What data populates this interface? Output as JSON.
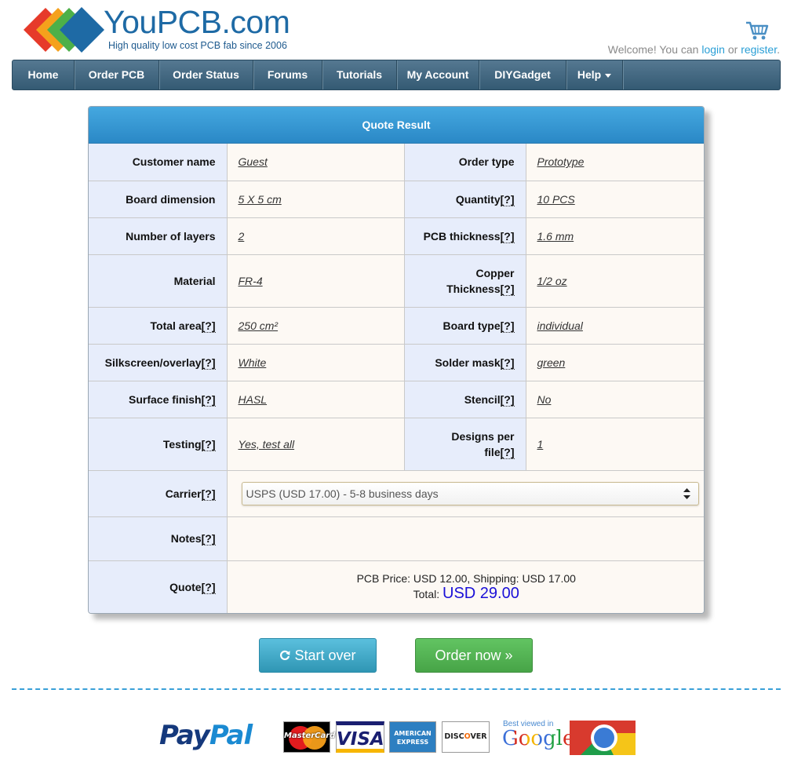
{
  "brand": {
    "name_you": "You",
    "name_pcb": "PCB",
    "name_dom": ".com",
    "tagline": "High quality low cost PCB fab since 2006"
  },
  "account": {
    "welcome_text": "Welcome! You can ",
    "login": "login",
    "or": " or ",
    "register": "register",
    "period": "."
  },
  "nav": [
    {
      "label": "Home"
    },
    {
      "label": "Order PCB"
    },
    {
      "label": "Order Status"
    },
    {
      "label": "Forums"
    },
    {
      "label": "Tutorials"
    },
    {
      "label": "My Account"
    },
    {
      "label": "DIYGadget"
    },
    {
      "label": "Help"
    }
  ],
  "quote": {
    "title": "Quote Result",
    "help_mark": "[?]",
    "rows": [
      {
        "l1": "Customer name",
        "v1": "Guest",
        "l2": "Order type",
        "v2": "Prototype"
      },
      {
        "l1": "Board dimension",
        "v1": "5 X 5 cm",
        "l2": "Quantity",
        "v2": "10 PCS"
      },
      {
        "l1": "Number of layers",
        "v1": "2",
        "l2": "PCB thickness",
        "v2": "1.6 mm"
      },
      {
        "l1": "Material",
        "v1": "FR-4",
        "l2a": "Copper",
        "l2b": "Thickness",
        "v2": "1/2 oz"
      },
      {
        "l1": "Total area",
        "v1": "250 cm²",
        "l2": "Board type",
        "v2": "individual"
      },
      {
        "l1": "Silkscreen/overlay",
        "v1": "White",
        "l2": "Solder mask",
        "v2": "green"
      },
      {
        "l1": "Surface finish",
        "v1": "HASL",
        "l2": "Stencil",
        "v2": "No"
      },
      {
        "l1": "Testing",
        "v1": "Yes, test all",
        "l2a": "Designs per",
        "l2b": "file",
        "v2": "1"
      }
    ],
    "carrier_label": "Carrier",
    "carrier_value": "USPS (USD 17.00) - 5-8 business days",
    "notes_label": "Notes",
    "notes_value": "",
    "quote_label": "Quote",
    "price_line": "PCB Price: USD 12.00, Shipping: USD 17.00",
    "total_label": "Total: ",
    "total_value": "USD 29.00"
  },
  "buttons": {
    "start_over": "Start over",
    "order_now": "Order now »"
  },
  "footer": {
    "paypal_1": "Pay",
    "paypal_2": "Pal",
    "mastercard": "MasterCard",
    "visa": "VISA",
    "amex_1": "AMERICAN",
    "amex_2": "EXPRESS",
    "discover_1": "DISC",
    "discover_2": "O",
    "discover_3": "VER",
    "best_viewed": "Best viewed in",
    "google": "Google"
  },
  "colors": {
    "accent": "#2a88c6",
    "nav": "#345a73",
    "label_bg": "#e7edfb",
    "value_bg": "#fdf9f4",
    "start_button": "#2f96b4",
    "order_button": "#47a447",
    "total": "#1a10d8"
  }
}
